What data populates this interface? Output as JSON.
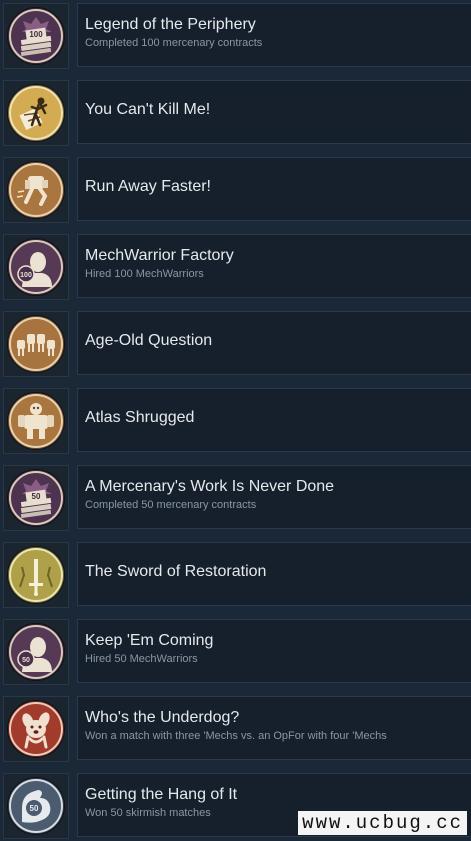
{
  "achievements": [
    {
      "title": "Legend of the Periphery",
      "desc": "Completed 100 mercenary contracts",
      "icon": "contracts-stack-icon",
      "badge": "100"
    },
    {
      "title": "You Can't Kill Me!",
      "desc": "",
      "icon": "cracked-shield-pilot-icon"
    },
    {
      "title": "Run Away Faster!",
      "desc": "",
      "icon": "running-mech-icon"
    },
    {
      "title": "MechWarrior Factory",
      "desc": "Hired 100 MechWarriors",
      "icon": "mechwarrior-portrait-icon",
      "badge": "100"
    },
    {
      "title": "Age-Old Question",
      "desc": "",
      "icon": "mech-lineup-icon"
    },
    {
      "title": "Atlas Shrugged",
      "desc": "",
      "icon": "atlas-mech-icon"
    },
    {
      "title": "A Mercenary's Work Is Never Done",
      "desc": "Completed 50 mercenary contracts",
      "icon": "contracts-stack-icon",
      "badge": "50"
    },
    {
      "title": "The Sword of Restoration",
      "desc": "",
      "icon": "sword-icon"
    },
    {
      "title": "Keep 'Em Coming",
      "desc": "Hired 50 MechWarriors",
      "icon": "mechwarrior-portrait-icon",
      "badge": "50"
    },
    {
      "title": "Who's the Underdog?",
      "desc": "Won a match with three 'Mechs vs. an OpFor with four 'Mechs",
      "icon": "dog-icon"
    },
    {
      "title": "Getting the Hang of It",
      "desc": "Won 50 skirmish matches",
      "icon": "flexed-arm-icon",
      "badge": "50"
    }
  ],
  "watermark": "www.ucbug.cc",
  "colors": {
    "background": "#1b2838",
    "panel": "#15202c",
    "title": "#e6e9ec",
    "description": "#8b96a3"
  }
}
